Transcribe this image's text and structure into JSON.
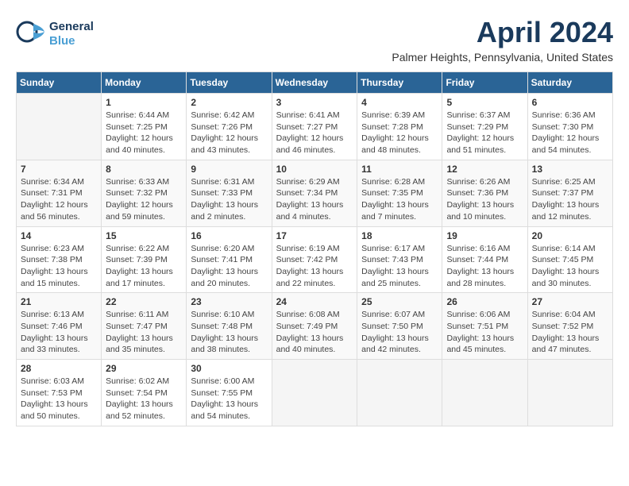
{
  "header": {
    "logo_general": "General",
    "logo_blue": "Blue",
    "month_title": "April 2024",
    "location": "Palmer Heights, Pennsylvania, United States"
  },
  "calendar": {
    "days_of_week": [
      "Sunday",
      "Monday",
      "Tuesday",
      "Wednesday",
      "Thursday",
      "Friday",
      "Saturday"
    ],
    "weeks": [
      [
        {
          "day": "",
          "info": ""
        },
        {
          "day": "1",
          "info": "Sunrise: 6:44 AM\nSunset: 7:25 PM\nDaylight: 12 hours\nand 40 minutes."
        },
        {
          "day": "2",
          "info": "Sunrise: 6:42 AM\nSunset: 7:26 PM\nDaylight: 12 hours\nand 43 minutes."
        },
        {
          "day": "3",
          "info": "Sunrise: 6:41 AM\nSunset: 7:27 PM\nDaylight: 12 hours\nand 46 minutes."
        },
        {
          "day": "4",
          "info": "Sunrise: 6:39 AM\nSunset: 7:28 PM\nDaylight: 12 hours\nand 48 minutes."
        },
        {
          "day": "5",
          "info": "Sunrise: 6:37 AM\nSunset: 7:29 PM\nDaylight: 12 hours\nand 51 minutes."
        },
        {
          "day": "6",
          "info": "Sunrise: 6:36 AM\nSunset: 7:30 PM\nDaylight: 12 hours\nand 54 minutes."
        }
      ],
      [
        {
          "day": "7",
          "info": "Sunrise: 6:34 AM\nSunset: 7:31 PM\nDaylight: 12 hours\nand 56 minutes."
        },
        {
          "day": "8",
          "info": "Sunrise: 6:33 AM\nSunset: 7:32 PM\nDaylight: 12 hours\nand 59 minutes."
        },
        {
          "day": "9",
          "info": "Sunrise: 6:31 AM\nSunset: 7:33 PM\nDaylight: 13 hours\nand 2 minutes."
        },
        {
          "day": "10",
          "info": "Sunrise: 6:29 AM\nSunset: 7:34 PM\nDaylight: 13 hours\nand 4 minutes."
        },
        {
          "day": "11",
          "info": "Sunrise: 6:28 AM\nSunset: 7:35 PM\nDaylight: 13 hours\nand 7 minutes."
        },
        {
          "day": "12",
          "info": "Sunrise: 6:26 AM\nSunset: 7:36 PM\nDaylight: 13 hours\nand 10 minutes."
        },
        {
          "day": "13",
          "info": "Sunrise: 6:25 AM\nSunset: 7:37 PM\nDaylight: 13 hours\nand 12 minutes."
        }
      ],
      [
        {
          "day": "14",
          "info": "Sunrise: 6:23 AM\nSunset: 7:38 PM\nDaylight: 13 hours\nand 15 minutes."
        },
        {
          "day": "15",
          "info": "Sunrise: 6:22 AM\nSunset: 7:39 PM\nDaylight: 13 hours\nand 17 minutes."
        },
        {
          "day": "16",
          "info": "Sunrise: 6:20 AM\nSunset: 7:41 PM\nDaylight: 13 hours\nand 20 minutes."
        },
        {
          "day": "17",
          "info": "Sunrise: 6:19 AM\nSunset: 7:42 PM\nDaylight: 13 hours\nand 22 minutes."
        },
        {
          "day": "18",
          "info": "Sunrise: 6:17 AM\nSunset: 7:43 PM\nDaylight: 13 hours\nand 25 minutes."
        },
        {
          "day": "19",
          "info": "Sunrise: 6:16 AM\nSunset: 7:44 PM\nDaylight: 13 hours\nand 28 minutes."
        },
        {
          "day": "20",
          "info": "Sunrise: 6:14 AM\nSunset: 7:45 PM\nDaylight: 13 hours\nand 30 minutes."
        }
      ],
      [
        {
          "day": "21",
          "info": "Sunrise: 6:13 AM\nSunset: 7:46 PM\nDaylight: 13 hours\nand 33 minutes."
        },
        {
          "day": "22",
          "info": "Sunrise: 6:11 AM\nSunset: 7:47 PM\nDaylight: 13 hours\nand 35 minutes."
        },
        {
          "day": "23",
          "info": "Sunrise: 6:10 AM\nSunset: 7:48 PM\nDaylight: 13 hours\nand 38 minutes."
        },
        {
          "day": "24",
          "info": "Sunrise: 6:08 AM\nSunset: 7:49 PM\nDaylight: 13 hours\nand 40 minutes."
        },
        {
          "day": "25",
          "info": "Sunrise: 6:07 AM\nSunset: 7:50 PM\nDaylight: 13 hours\nand 42 minutes."
        },
        {
          "day": "26",
          "info": "Sunrise: 6:06 AM\nSunset: 7:51 PM\nDaylight: 13 hours\nand 45 minutes."
        },
        {
          "day": "27",
          "info": "Sunrise: 6:04 AM\nSunset: 7:52 PM\nDaylight: 13 hours\nand 47 minutes."
        }
      ],
      [
        {
          "day": "28",
          "info": "Sunrise: 6:03 AM\nSunset: 7:53 PM\nDaylight: 13 hours\nand 50 minutes."
        },
        {
          "day": "29",
          "info": "Sunrise: 6:02 AM\nSunset: 7:54 PM\nDaylight: 13 hours\nand 52 minutes."
        },
        {
          "day": "30",
          "info": "Sunrise: 6:00 AM\nSunset: 7:55 PM\nDaylight: 13 hours\nand 54 minutes."
        },
        {
          "day": "",
          "info": ""
        },
        {
          "day": "",
          "info": ""
        },
        {
          "day": "",
          "info": ""
        },
        {
          "day": "",
          "info": ""
        }
      ]
    ]
  }
}
